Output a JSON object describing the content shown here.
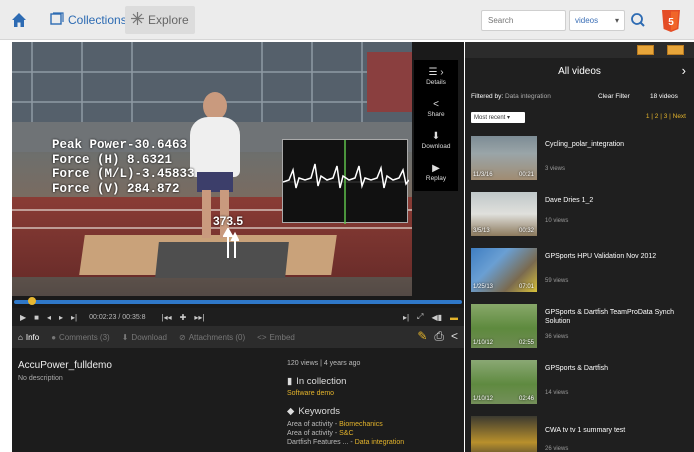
{
  "topbar": {
    "collections_label": "Collections",
    "explore_label": "Explore",
    "search_placeholder": "Search",
    "search_scope": "videos",
    "colors": {
      "accent": "#2d6bb3",
      "html5": "#e44d26"
    }
  },
  "video": {
    "overlay_lines": [
      "Peak Power-30.6463",
      "Force (H) 8.6321",
      "Force (M/L)-3.45833",
      "Force (V) 284.872"
    ],
    "force_value": "373.5"
  },
  "side_actions": [
    {
      "label": "Details",
      "icon": "details-icon"
    },
    {
      "label": "Share",
      "icon": "share-icon"
    },
    {
      "label": "Download",
      "icon": "download-icon"
    },
    {
      "label": "Replay",
      "icon": "play-icon"
    }
  ],
  "controls": {
    "timecode": "00:02:23 / 00:35:8",
    "progress": 0.04
  },
  "tabs": [
    {
      "label": "Info",
      "icon": "home-icon",
      "active": true
    },
    {
      "label": "Comments (3)",
      "icon": "comment-icon",
      "active": false
    },
    {
      "label": "Download",
      "icon": "download-icon",
      "active": false
    },
    {
      "label": "Attachments (0)",
      "icon": "paperclip-icon",
      "active": false
    },
    {
      "label": "Embed",
      "icon": "code-icon",
      "active": false
    }
  ],
  "info": {
    "title": "AccuPower_fulldemo",
    "description": "No description",
    "views": "120 views | 4 years ago",
    "in_collection_label": "In collection",
    "collection_name": "Software demo",
    "keywords_label": "Keywords",
    "keywords": [
      {
        "key": "Area of activity - ",
        "value": "Biomechanics"
      },
      {
        "key": "Area of activity - ",
        "value": "S&C"
      },
      {
        "key": "Dartfish Features ... - ",
        "value": "Data integration"
      }
    ]
  },
  "sidebar": {
    "title": "All videos",
    "filter_label": "Filtered by:",
    "filter_value": "Data integration",
    "clear_filter": "Clear Filter",
    "count": "18 videos",
    "sort": "Most recent",
    "pager": "1 | 2 | 3 | Next",
    "items": [
      {
        "title": "Cycling_polar_integration",
        "views": "3 views",
        "date": "11/3/16",
        "duration": "00:21"
      },
      {
        "title": "Dave Dries 1_2",
        "views": "10 views",
        "date": "3/5/13",
        "duration": "00:32"
      },
      {
        "title": "GPSports HPU Validation Nov 2012",
        "views": "59 views",
        "date": "1/25/13",
        "duration": "07:01"
      },
      {
        "title": "GPSports & Dartfish TeamProData Synch Solution",
        "views": "36 views",
        "date": "1/10/12",
        "duration": "02:55"
      },
      {
        "title": "GPSports & Dartfish",
        "views": "14 views",
        "date": "1/10/12",
        "duration": "02:46"
      },
      {
        "title": "CWA tv tv 1 summary test",
        "views": "26 views",
        "date": "",
        "duration": ""
      }
    ]
  }
}
